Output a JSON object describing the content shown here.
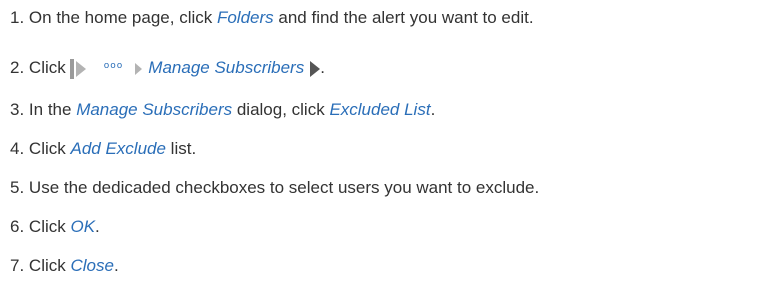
{
  "steps": [
    {
      "num": "1.",
      "before": "On the home page, click ",
      "ui": "Folders",
      "after": " and find the alert you want to edit."
    },
    {
      "num": "2.",
      "before": "Click",
      "icons": [
        "filter-bar-icon",
        "play-icon",
        "more-dots-icon",
        "chevron-right-icon",
        "end-arrow-icon"
      ],
      "dots": "ooo",
      "ui": "Manage Subscribers",
      "after": "."
    },
    {
      "num": "3.",
      "before": "In the ",
      "ui": "Manage Subscribers",
      "middle": " dialog, click ",
      "ui2": "Excluded List",
      "after": "."
    },
    {
      "num": "4.",
      "before": "Click ",
      "ui": "Add Exclude",
      "after": " list."
    },
    {
      "num": "5.",
      "before": "Use the dedicaded checkboxes to select users you want to exclude.",
      "ui": "",
      "after": ""
    },
    {
      "num": "6.",
      "before": "Click ",
      "ui": "OK",
      "after": "."
    },
    {
      "num": "7.",
      "before": "Click ",
      "ui": "Close",
      "after": "."
    }
  ],
  "colors": {
    "text": "#333333",
    "ui_link": "#2a6eb8",
    "icon_gray": "#b3b3b3"
  }
}
